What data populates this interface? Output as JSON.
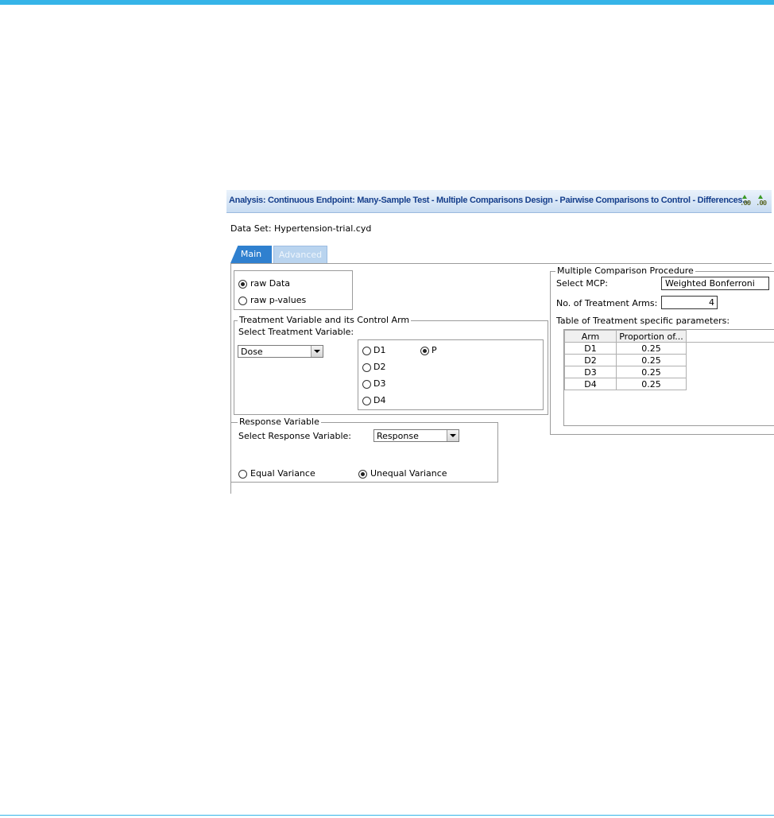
{
  "window": {
    "title": "Analysis: Continuous Endpoint: Many-Sample Test - Multiple Comparisons Design - Pairwise Comparisons to Control - Differences...",
    "icons": [
      "decimal-increase-icon",
      "decimal-decrease-icon"
    ],
    "icon_text": ".00"
  },
  "dataset": "Data Set: Hypertension-trial.cyd",
  "tabs": [
    "Main",
    "Advanced"
  ],
  "input_type": {
    "options": [
      "raw Data",
      "raw p-values"
    ],
    "selected": "raw Data"
  },
  "treatment": {
    "legend": "Treatment Variable and its Control Arm",
    "select_label": "Select Treatment Variable:",
    "selected_variable": "Dose",
    "arms": [
      "D1",
      "D2",
      "D3",
      "D4",
      "P"
    ],
    "control_arm": "P"
  },
  "response": {
    "legend": "Response Variable",
    "select_label": "Select Response Variable:",
    "selected_variable": "Response",
    "variance_options": [
      "Equal Variance",
      "Unequal Variance"
    ],
    "variance_selected": "Unequal Variance"
  },
  "mcp": {
    "legend": "Multiple Comparison Procedure",
    "select_label": "Select MCP:",
    "selected": "Weighted Bonferroni",
    "arms_label": "No. of Treatment Arms:",
    "arms_value": "4",
    "table_label": "Table of Treatment specific parameters:",
    "columns": [
      "Arm",
      "Proportion of..."
    ],
    "rows": [
      [
        "D1",
        "0.25"
      ],
      [
        "D2",
        "0.25"
      ],
      [
        "D3",
        "0.25"
      ],
      [
        "D4",
        "0.25"
      ]
    ]
  },
  "colors": {
    "accent": "#36b4e8",
    "title_text": "#163f8c",
    "tab_active": "#2f80cf",
    "tab_inactive": "#b9d4ef"
  }
}
